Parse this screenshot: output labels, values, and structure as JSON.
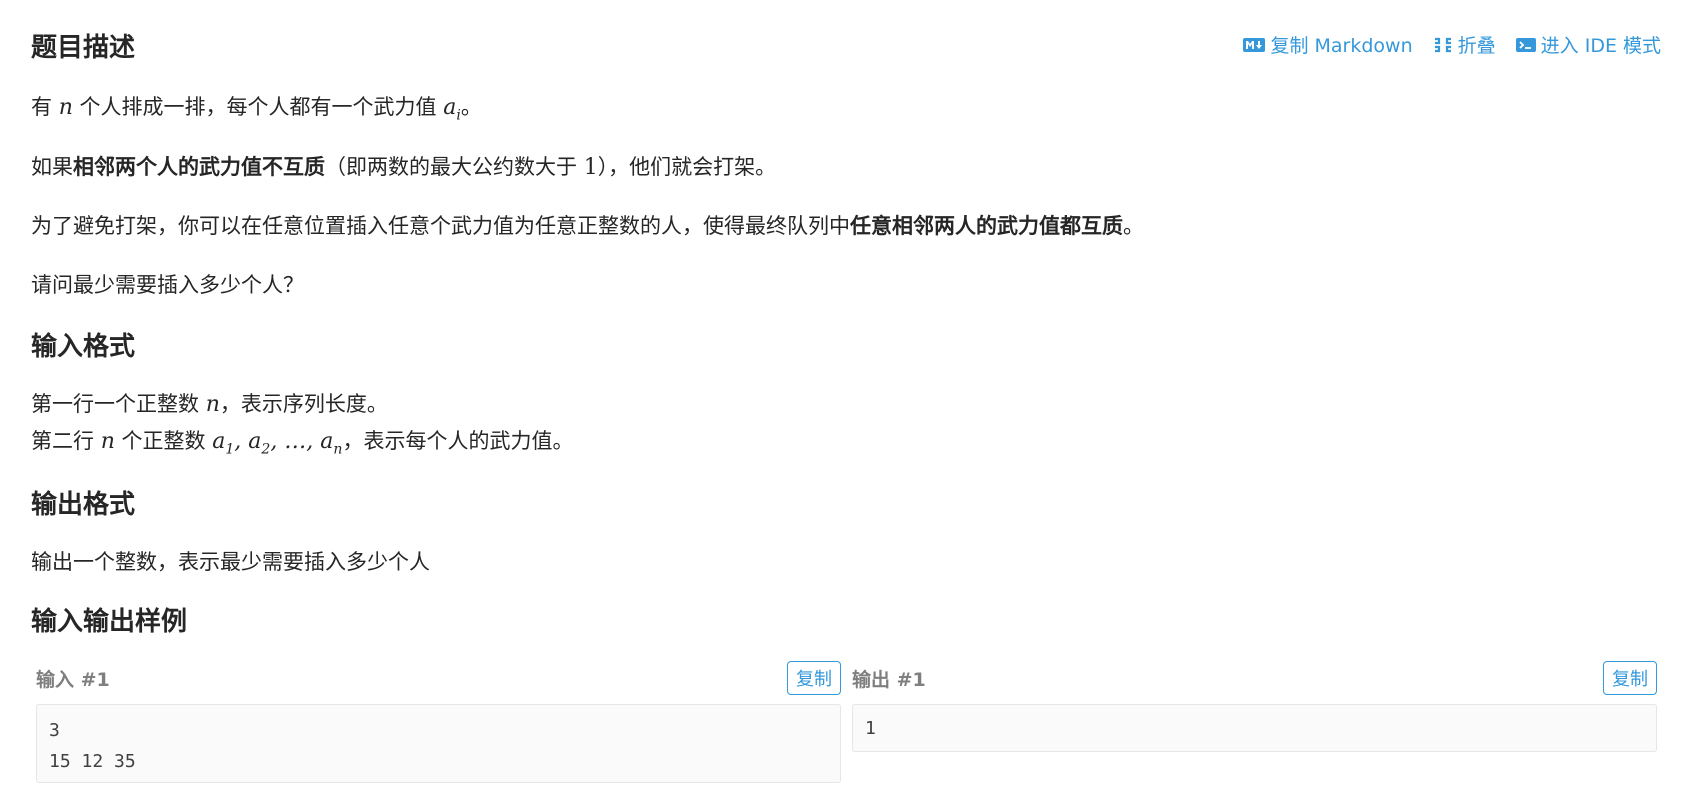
{
  "toolbar": {
    "copy_markdown": "复制 Markdown",
    "fold": "折叠",
    "ide_mode": "进入 IDE 模式",
    "icons": [
      "markdown-icon",
      "collapse-icon",
      "terminal-icon"
    ],
    "accent_color": "#3498db"
  },
  "sections": {
    "description_title": "题目描述",
    "input_format_title": "输入格式",
    "output_format_title": "输出格式",
    "samples_title": "输入输出样例"
  },
  "description": {
    "p1": {
      "before": "有 ",
      "var_n": "n",
      "middle": " 个人排成一排，每个人都有一个武力值 ",
      "var_a": "a",
      "sub_i": "i",
      "after": "。"
    },
    "p2": {
      "before": "如果",
      "bold": "相邻两个人的武力值不互质",
      "middle": "（即两数的最大公约数大于 ",
      "num": "1",
      "after": "），他们就会打架。"
    },
    "p3": {
      "before": "为了避免打架，你可以在任意位置插入任意个武力值为任意正整数的人，使得最终队列中",
      "bold": "任意相邻两人的武力值都互质",
      "after": "。"
    },
    "p4": "请问最少需要插入多少个人？"
  },
  "input_format": {
    "line1": {
      "before": "第一行一个正整数 ",
      "var_n": "n",
      "after": "，表示序列长度。"
    },
    "line2": {
      "before": "第二行 ",
      "var_n": "n",
      "middle": " 个正整数 ",
      "a": "a",
      "s1": "1",
      "comma1": ", ",
      "s2": "2",
      "dots": ", …, ",
      "sn": "n",
      "after": "，表示每个人的武力值。"
    }
  },
  "output_format": {
    "line": "输出一个整数，表示最少需要插入多少个人"
  },
  "samples": {
    "input_title": "输入 #1",
    "output_title": "输出 #1",
    "copy_label": "复制",
    "input_text": "3\n15 12 35",
    "output_text": "1"
  }
}
